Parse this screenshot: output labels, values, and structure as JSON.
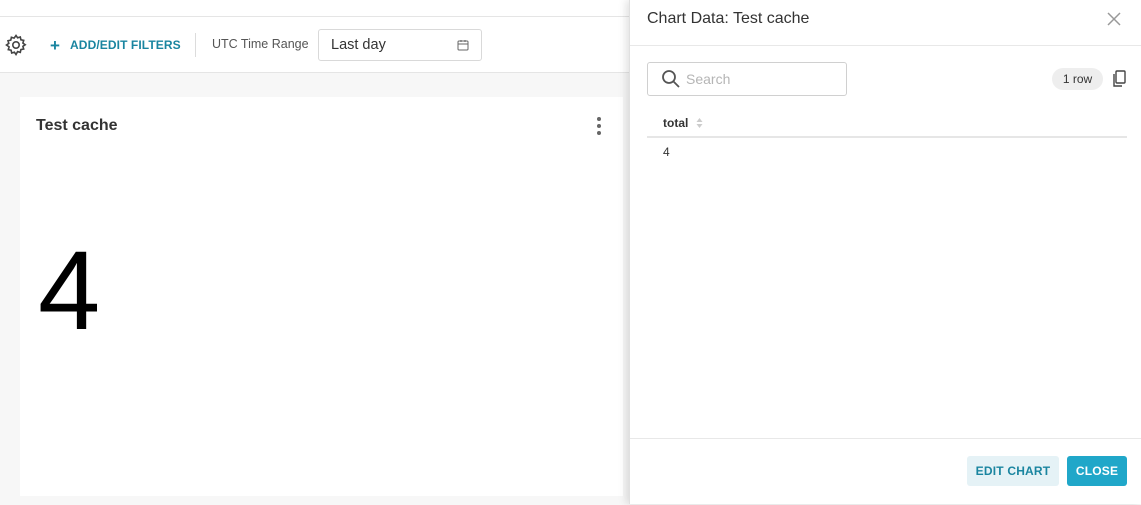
{
  "filterbar": {
    "add_filters_label": "ADD/EDIT FILTERS",
    "time_range_label": "UTC Time Range",
    "time_range_value": "Last day"
  },
  "chart_card": {
    "title": "Test cache",
    "big_number": "4"
  },
  "modal": {
    "title": "Chart Data: Test cache",
    "search_placeholder": "Search",
    "row_count": "1 row",
    "columns": [
      "total"
    ],
    "rows": [
      [
        "4"
      ]
    ],
    "edit_chart_label": "EDIT CHART",
    "close_label": "CLOSE"
  },
  "colors": {
    "accent": "#20a7c9",
    "accent_text": "#1a85a0",
    "accent_light": "#e5f2f6"
  },
  "icons": [
    "gear-icon",
    "plus-icon",
    "calendar-icon",
    "kebab-menu-icon",
    "close-icon",
    "search-icon",
    "copy-icon",
    "sort-icon"
  ]
}
